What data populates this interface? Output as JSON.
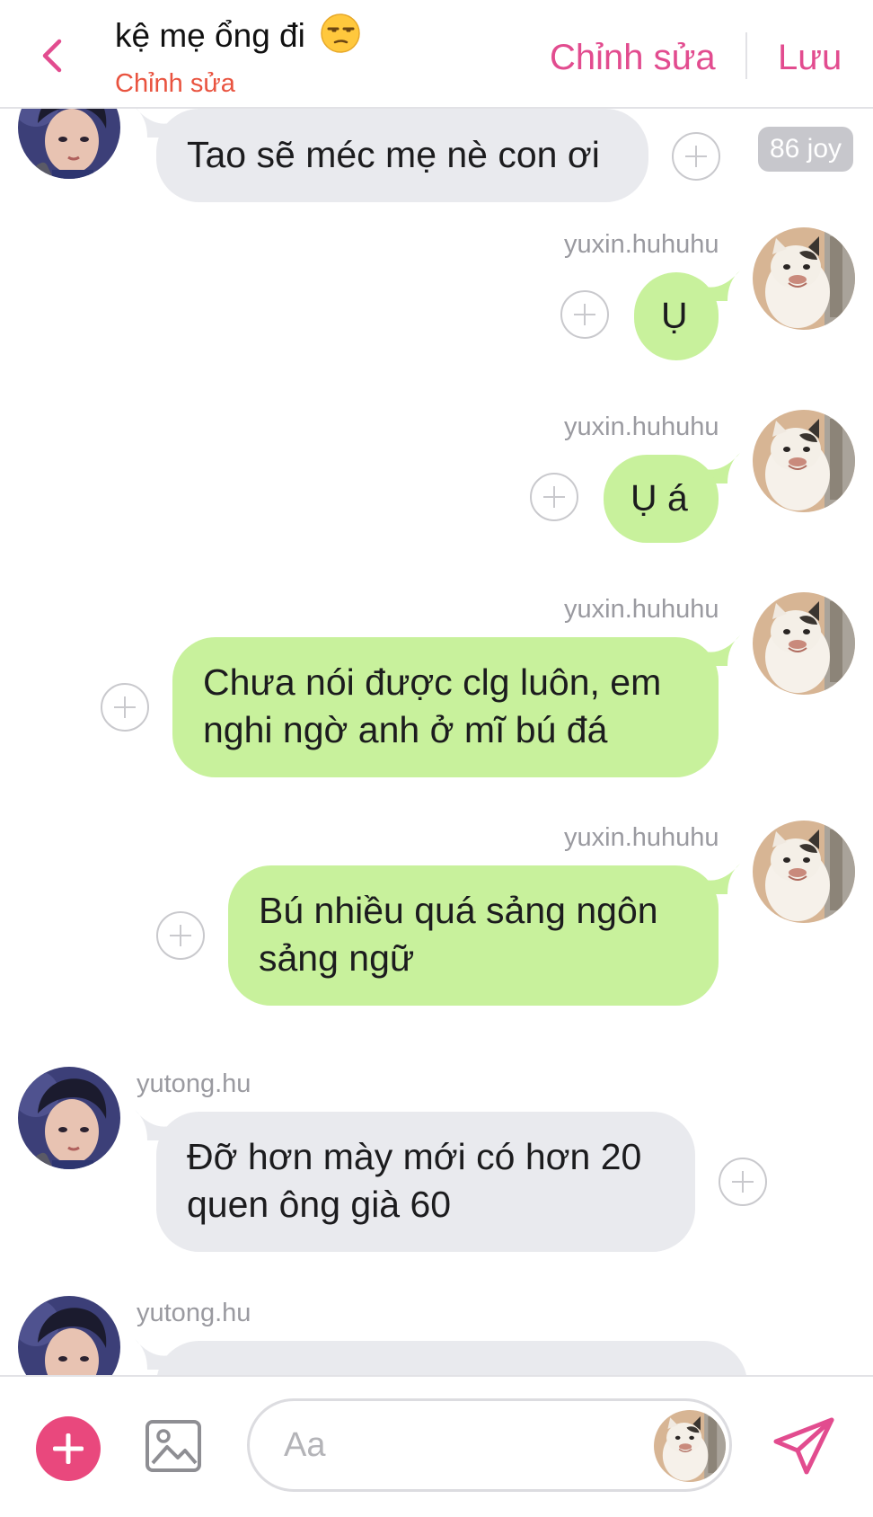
{
  "header": {
    "title": "kệ mẹ ổng đi",
    "title_emoji": "unamused-face",
    "subtitle": "Chỉnh sửa",
    "edit_label": "Chỉnh sửa",
    "save_label": "Lưu"
  },
  "messages": [
    {
      "sender": "yutong.hu",
      "direction": "incoming",
      "text": "Tao sẽ méc mẹ nè con ơi",
      "reaction_badge": "86 joy"
    },
    {
      "sender": "yuxin.huhuhu",
      "direction": "outgoing",
      "text": "Ụ"
    },
    {
      "sender": "yuxin.huhuhu",
      "direction": "outgoing",
      "text": "Ụ á"
    },
    {
      "sender": "yuxin.huhuhu",
      "direction": "outgoing",
      "lines": [
        "Chưa nói được clg luôn, em",
        "nghi ngờ anh ở mĩ bú đá"
      ]
    },
    {
      "sender": "yuxin.huhuhu",
      "direction": "outgoing",
      "lines": [
        "Bú nhiều quá sảng ngôn",
        "sảng ngữ"
      ]
    },
    {
      "sender": "yutong.hu",
      "direction": "incoming",
      "lines": [
        "Đỡ hơn mày mới có hơn 20",
        "quen ông già 60"
      ]
    },
    {
      "sender": "yutong.hu",
      "direction": "incoming",
      "text": ""
    }
  ],
  "composer": {
    "placeholder": "Aa",
    "icons": [
      "plus-icon",
      "image-icon",
      "send-icon"
    ]
  },
  "colors": {
    "accent": "#e24c8f",
    "subtitle": "#e9533f",
    "outgoing_bubble": "#c8f19c",
    "incoming_bubble": "#e9eaee"
  }
}
